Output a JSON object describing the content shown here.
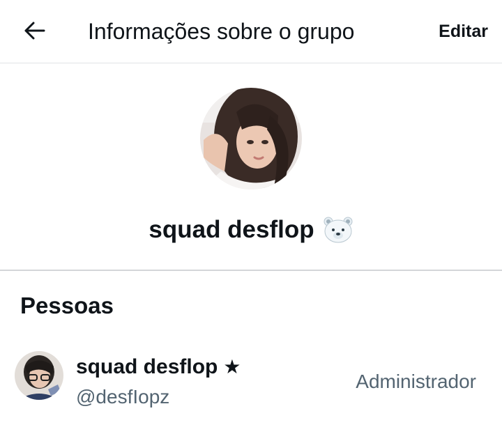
{
  "header": {
    "title": "Informações sobre o grupo",
    "edit_label": "Editar",
    "back_icon": "arrow-left-icon"
  },
  "group": {
    "name": "squad desflop",
    "emoji_icon": "polar-bear-face-icon"
  },
  "people": {
    "heading": "Pessoas",
    "members": [
      {
        "name": "squad desflop",
        "badge_icon": "star-icon",
        "badge_glyph": "★",
        "handle": "@desfIopz",
        "role": "Administrador"
      }
    ]
  },
  "colors": {
    "text_primary": "#0f1419",
    "text_secondary": "#536471",
    "divider": "#e1e4e6"
  }
}
